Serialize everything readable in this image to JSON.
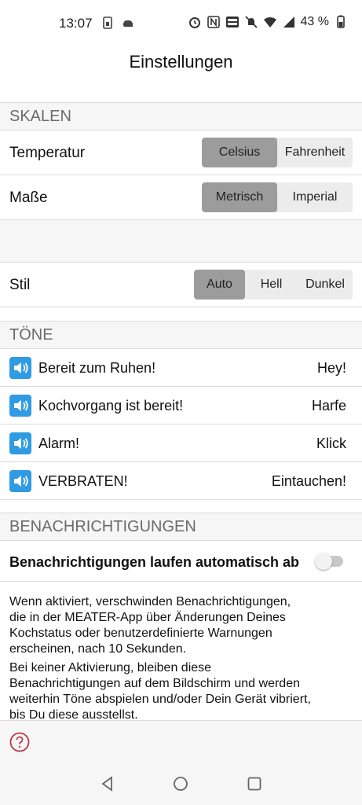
{
  "status": {
    "time": "13:07",
    "battery": "43 %",
    "icons": [
      "sim-icon",
      "cloud-icon",
      "alarm-icon",
      "nfc-icon",
      "volte-icon",
      "mute-icon",
      "wifi-icon",
      "signal-icon",
      "battery-icon"
    ]
  },
  "header": {
    "title": "Einstellungen"
  },
  "scales": {
    "section_title": "SKALEN",
    "temperature": {
      "label": "Temperatur",
      "options": [
        "Celsius",
        "Fahrenheit"
      ],
      "selected": "Celsius"
    },
    "measures": {
      "label": "Maße",
      "options": [
        "Metrisch",
        "Imperial"
      ],
      "selected": "Metrisch"
    }
  },
  "style": {
    "label": "Stil",
    "options": [
      "Auto",
      "Hell",
      "Dunkel"
    ],
    "selected": "Auto"
  },
  "tones": {
    "section_title": "TÖNE",
    "items": [
      {
        "name": "Bereit zum Ruhen!",
        "value": "Hey!"
      },
      {
        "name": "Kochvorgang ist bereit!",
        "value": "Harfe"
      },
      {
        "name": "Alarm!",
        "value": "Klick"
      },
      {
        "name": "VERBRATEN!",
        "value": "Eintauchen!"
      }
    ]
  },
  "notifications": {
    "section_title": "BENACHRICHTIGUNGEN",
    "auto_dismiss_label": "Benachrichtigungen laufen automatisch ab",
    "auto_dismiss_enabled": false,
    "description_1_lines": [
      "Wenn aktiviert, verschwinden Benachrichtigungen,",
      "die in der MEATER-App über Änderungen Deines",
      "Kochstatus oder benutzerdefinierte Warnungen",
      "erscheinen, nach 10 Sekunden."
    ],
    "description_2_lines": [
      "Bei keiner Aktivierung, bleiben diese",
      "Benachrichtigungen auf dem Bildschirm und werden",
      "weiterhin Töne abspielen und/oder Dein Gerät vibriert,",
      "bis Du diese ausstellst."
    ]
  },
  "colors": {
    "accent": "#2f9be3",
    "segment_active": "#9c9c9c",
    "help": "#c0344a"
  }
}
